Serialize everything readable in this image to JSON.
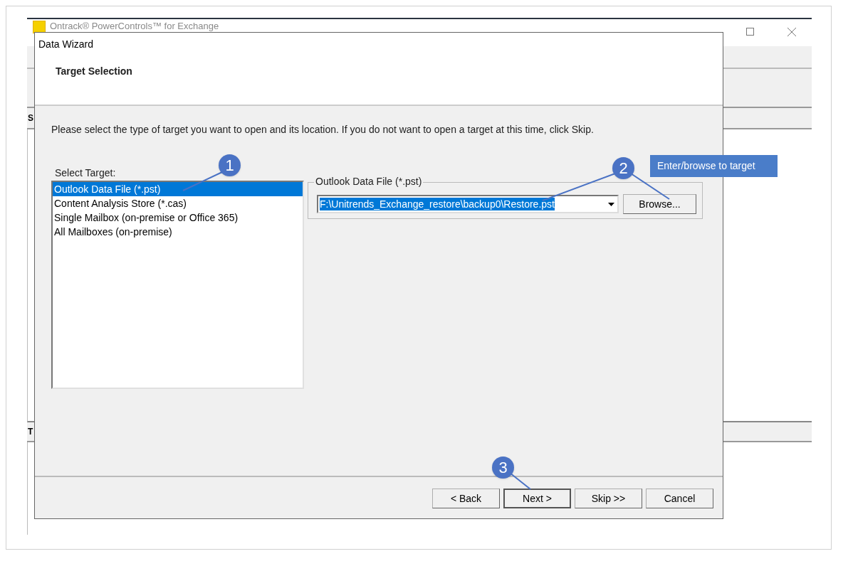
{
  "app_window": {
    "title": "Ontrack® PowerControls™ for Exchange",
    "pane_labels": [
      "S",
      "T"
    ]
  },
  "dialog": {
    "title": "Data Wizard",
    "heading": "Target Selection",
    "instructions": "Please select the type of target you want to open and its location. If you do not want to open a target at this time, click Skip.",
    "select_label": "Select Target:",
    "targets": [
      {
        "label": "Outlook Data File (*.pst)",
        "selected": true
      },
      {
        "label": "Content Analysis Store (*.cas)",
        "selected": false
      },
      {
        "label": "Single Mailbox (on-premise or Office 365)",
        "selected": false
      },
      {
        "label": "All Mailboxes (on-premise)",
        "selected": false
      }
    ],
    "group_label": "Outlook Data File (*.pst)",
    "path_value": "F:\\Unitrends_Exchange_restore\\backup0\\Restore.pst",
    "browse_button": "Browse...",
    "buttons": [
      {
        "label": "< Back",
        "default": false
      },
      {
        "label": "Next >",
        "default": true
      },
      {
        "label": "Skip >>",
        "default": false
      },
      {
        "label": "Cancel",
        "default": false
      }
    ]
  },
  "callouts": [
    {
      "number": "1"
    },
    {
      "number": "2"
    },
    {
      "number": "3"
    }
  ],
  "note": "Enter/browse to target"
}
